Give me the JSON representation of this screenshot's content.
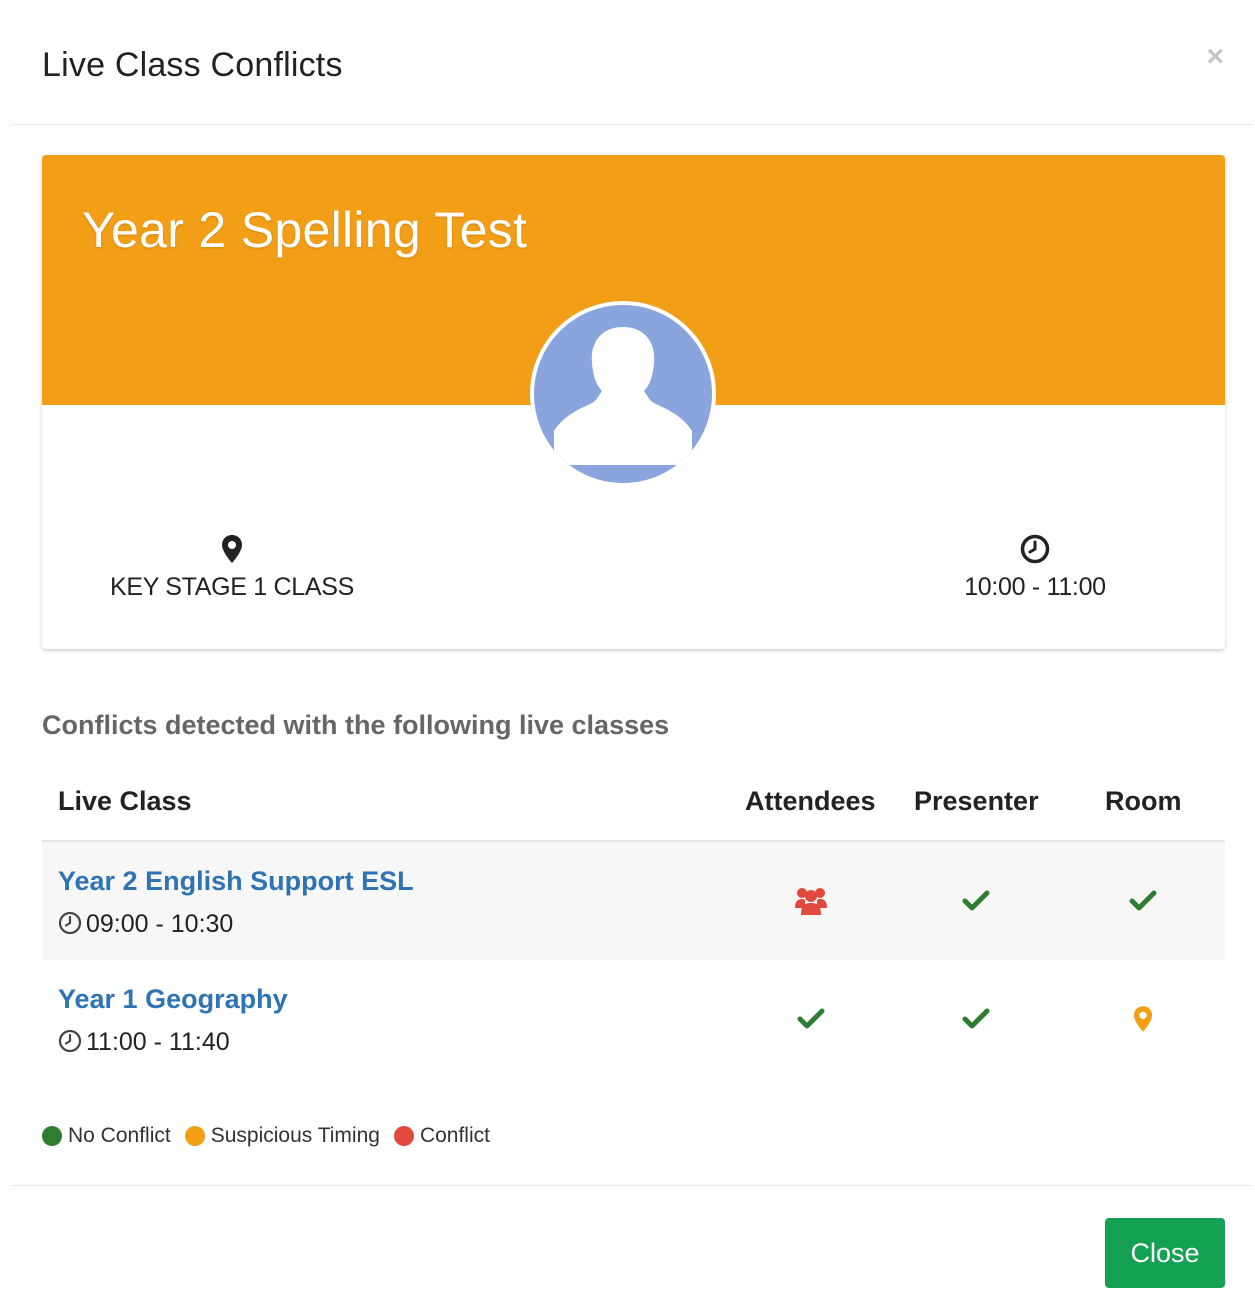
{
  "modal": {
    "title": "Live Class Conflicts",
    "close_symbol": "×"
  },
  "card": {
    "title": "Year 2 Spelling Test",
    "banner_color": "#f29e17",
    "location_icon": "map-marker-icon",
    "location": "KEY STAGE 1 CLASS",
    "time_icon": "clock-icon",
    "time": "10:00 - 11:00"
  },
  "conflicts": {
    "heading": "Conflicts detected with the following live classes",
    "columns": {
      "live_class": "Live Class",
      "attendees": "Attendees",
      "presenter": "Presenter",
      "room": "Room"
    },
    "rows": [
      {
        "name": "Year 2 English Support ESL",
        "time": "09:00 - 10:30",
        "attendees": "conflict",
        "presenter": "no-conflict",
        "room": "no-conflict"
      },
      {
        "name": "Year 1 Geography",
        "time": "11:00 - 11:40",
        "attendees": "no-conflict",
        "presenter": "no-conflict",
        "room": "suspicious-timing"
      }
    ]
  },
  "legend": {
    "no_conflict": {
      "label": "No Conflict",
      "color": "#2e7d32"
    },
    "suspicious": {
      "label": "Suspicious Timing",
      "color": "#f29e17"
    },
    "conflict": {
      "label": "Conflict",
      "color": "#e04a3c"
    }
  },
  "footer": {
    "close_label": "Close"
  }
}
